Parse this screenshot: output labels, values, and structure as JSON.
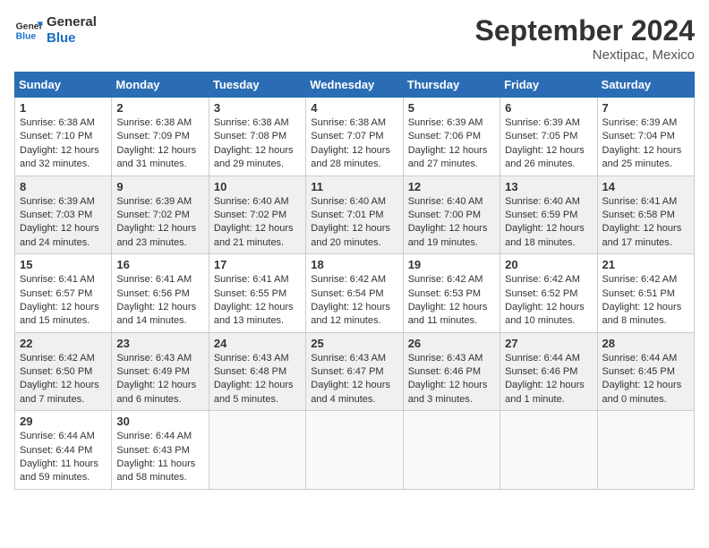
{
  "logo": {
    "line1": "General",
    "line2": "Blue"
  },
  "title": "September 2024",
  "location": "Nextipac, Mexico",
  "days_of_week": [
    "Sunday",
    "Monday",
    "Tuesday",
    "Wednesday",
    "Thursday",
    "Friday",
    "Saturday"
  ],
  "weeks": [
    [
      {
        "day": "1",
        "text": "Sunrise: 6:38 AM\nSunset: 7:10 PM\nDaylight: 12 hours and 32 minutes."
      },
      {
        "day": "2",
        "text": "Sunrise: 6:38 AM\nSunset: 7:09 PM\nDaylight: 12 hours and 31 minutes."
      },
      {
        "day": "3",
        "text": "Sunrise: 6:38 AM\nSunset: 7:08 PM\nDaylight: 12 hours and 29 minutes."
      },
      {
        "day": "4",
        "text": "Sunrise: 6:38 AM\nSunset: 7:07 PM\nDaylight: 12 hours and 28 minutes."
      },
      {
        "day": "5",
        "text": "Sunrise: 6:39 AM\nSunset: 7:06 PM\nDaylight: 12 hours and 27 minutes."
      },
      {
        "day": "6",
        "text": "Sunrise: 6:39 AM\nSunset: 7:05 PM\nDaylight: 12 hours and 26 minutes."
      },
      {
        "day": "7",
        "text": "Sunrise: 6:39 AM\nSunset: 7:04 PM\nDaylight: 12 hours and 25 minutes."
      }
    ],
    [
      {
        "day": "8",
        "text": "Sunrise: 6:39 AM\nSunset: 7:03 PM\nDaylight: 12 hours and 24 minutes."
      },
      {
        "day": "9",
        "text": "Sunrise: 6:39 AM\nSunset: 7:02 PM\nDaylight: 12 hours and 23 minutes."
      },
      {
        "day": "10",
        "text": "Sunrise: 6:40 AM\nSunset: 7:02 PM\nDaylight: 12 hours and 21 minutes."
      },
      {
        "day": "11",
        "text": "Sunrise: 6:40 AM\nSunset: 7:01 PM\nDaylight: 12 hours and 20 minutes."
      },
      {
        "day": "12",
        "text": "Sunrise: 6:40 AM\nSunset: 7:00 PM\nDaylight: 12 hours and 19 minutes."
      },
      {
        "day": "13",
        "text": "Sunrise: 6:40 AM\nSunset: 6:59 PM\nDaylight: 12 hours and 18 minutes."
      },
      {
        "day": "14",
        "text": "Sunrise: 6:41 AM\nSunset: 6:58 PM\nDaylight: 12 hours and 17 minutes."
      }
    ],
    [
      {
        "day": "15",
        "text": "Sunrise: 6:41 AM\nSunset: 6:57 PM\nDaylight: 12 hours and 15 minutes."
      },
      {
        "day": "16",
        "text": "Sunrise: 6:41 AM\nSunset: 6:56 PM\nDaylight: 12 hours and 14 minutes."
      },
      {
        "day": "17",
        "text": "Sunrise: 6:41 AM\nSunset: 6:55 PM\nDaylight: 12 hours and 13 minutes."
      },
      {
        "day": "18",
        "text": "Sunrise: 6:42 AM\nSunset: 6:54 PM\nDaylight: 12 hours and 12 minutes."
      },
      {
        "day": "19",
        "text": "Sunrise: 6:42 AM\nSunset: 6:53 PM\nDaylight: 12 hours and 11 minutes."
      },
      {
        "day": "20",
        "text": "Sunrise: 6:42 AM\nSunset: 6:52 PM\nDaylight: 12 hours and 10 minutes."
      },
      {
        "day": "21",
        "text": "Sunrise: 6:42 AM\nSunset: 6:51 PM\nDaylight: 12 hours and 8 minutes."
      }
    ],
    [
      {
        "day": "22",
        "text": "Sunrise: 6:42 AM\nSunset: 6:50 PM\nDaylight: 12 hours and 7 minutes."
      },
      {
        "day": "23",
        "text": "Sunrise: 6:43 AM\nSunset: 6:49 PM\nDaylight: 12 hours and 6 minutes."
      },
      {
        "day": "24",
        "text": "Sunrise: 6:43 AM\nSunset: 6:48 PM\nDaylight: 12 hours and 5 minutes."
      },
      {
        "day": "25",
        "text": "Sunrise: 6:43 AM\nSunset: 6:47 PM\nDaylight: 12 hours and 4 minutes."
      },
      {
        "day": "26",
        "text": "Sunrise: 6:43 AM\nSunset: 6:46 PM\nDaylight: 12 hours and 3 minutes."
      },
      {
        "day": "27",
        "text": "Sunrise: 6:44 AM\nSunset: 6:46 PM\nDaylight: 12 hours and 1 minute."
      },
      {
        "day": "28",
        "text": "Sunrise: 6:44 AM\nSunset: 6:45 PM\nDaylight: 12 hours and 0 minutes."
      }
    ],
    [
      {
        "day": "29",
        "text": "Sunrise: 6:44 AM\nSunset: 6:44 PM\nDaylight: 11 hours and 59 minutes."
      },
      {
        "day": "30",
        "text": "Sunrise: 6:44 AM\nSunset: 6:43 PM\nDaylight: 11 hours and 58 minutes."
      },
      {
        "day": "",
        "text": ""
      },
      {
        "day": "",
        "text": ""
      },
      {
        "day": "",
        "text": ""
      },
      {
        "day": "",
        "text": ""
      },
      {
        "day": "",
        "text": ""
      }
    ]
  ]
}
